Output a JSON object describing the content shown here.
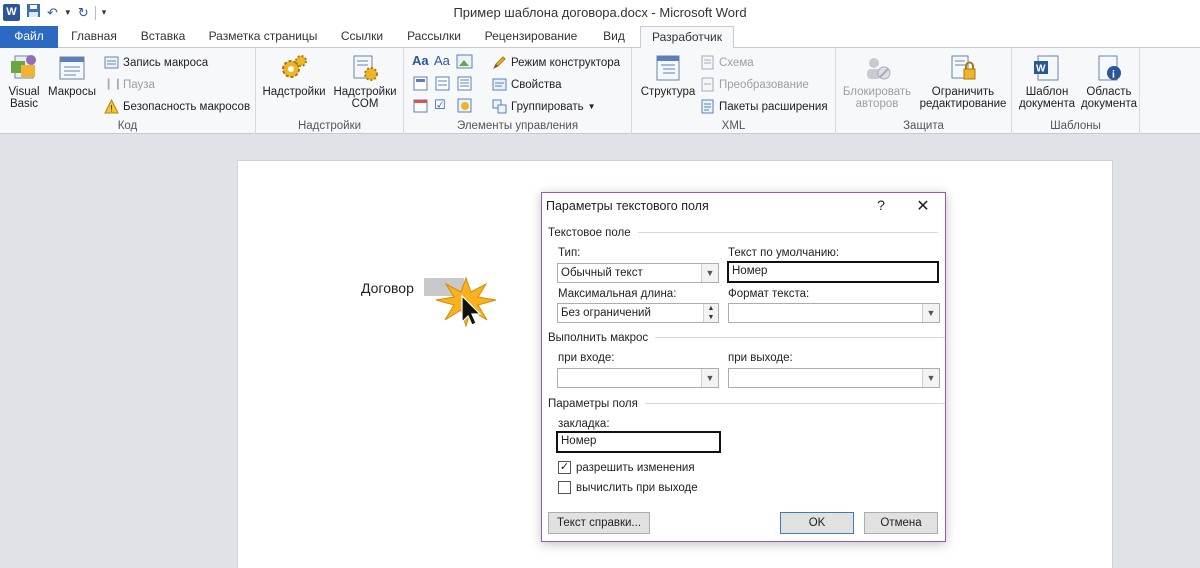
{
  "window": {
    "title": "Пример шаблона договора.docx  -  Microsoft Word"
  },
  "tabs": {
    "file": "Файл",
    "home": "Главная",
    "insert": "Вставка",
    "layout": "Разметка страницы",
    "references": "Ссылки",
    "mailings": "Рассылки",
    "review": "Рецензирование",
    "view": "Вид",
    "developer": "Разработчик"
  },
  "ribbon": {
    "code": {
      "label": "Код",
      "visual_basic": "Visual Basic",
      "macros": "Макросы",
      "record_macro": "Запись макроса",
      "pause": "Пауза",
      "macro_security": "Безопасность макросов"
    },
    "addins": {
      "label": "Надстройки",
      "addins": "Надстройки",
      "com_addins": "Надстройки COM"
    },
    "controls": {
      "label": "Элементы управления",
      "design_mode": "Режим конструктора",
      "properties": "Свойства",
      "group": "Группировать"
    },
    "xml": {
      "label": "XML",
      "structure": "Структура",
      "schema": "Схема",
      "transform": "Преобразование",
      "expansion_packs": "Пакеты расширения"
    },
    "protect": {
      "label": "Защита",
      "block_authors": "Блокировать авторов",
      "restrict_editing": "Ограничить редактирование"
    },
    "templates": {
      "label": "Шаблоны",
      "document_template": "Шаблон документа",
      "document_panel": "Область документа"
    }
  },
  "document": {
    "label": "Договор"
  },
  "dialog": {
    "title": "Параметры текстового поля",
    "help": "?",
    "close": "✕",
    "section_text_field": "Текстовое поле",
    "type_label": "Тип:",
    "type_value": "Обычный текст",
    "default_text_label": "Текст по умолчанию:",
    "default_text_value": "Номер",
    "max_length_label": "Максимальная длина:",
    "max_length_value": "Без ограничений",
    "text_format_label": "Формат текста:",
    "text_format_value": "",
    "section_run_macro": "Выполнить макрос",
    "on_entry_label": "при входе:",
    "on_exit_label": "при выходе:",
    "section_field_settings": "Параметры поля",
    "bookmark_label": "закладка:",
    "bookmark_value": "Номер",
    "fill_in_enabled": "разрешить изменения",
    "fill_in_enabled_checked": true,
    "calculate_on_exit": "вычислить при выходе",
    "calculate_on_exit_checked": false,
    "help_text_button": "Текст справки...",
    "ok_button": "OK",
    "cancel_button": "Отмена"
  },
  "colors": {
    "file_tab": "#2b6ac3",
    "dialog_border": "#9b59b6",
    "word_blue": "#2b579a"
  }
}
